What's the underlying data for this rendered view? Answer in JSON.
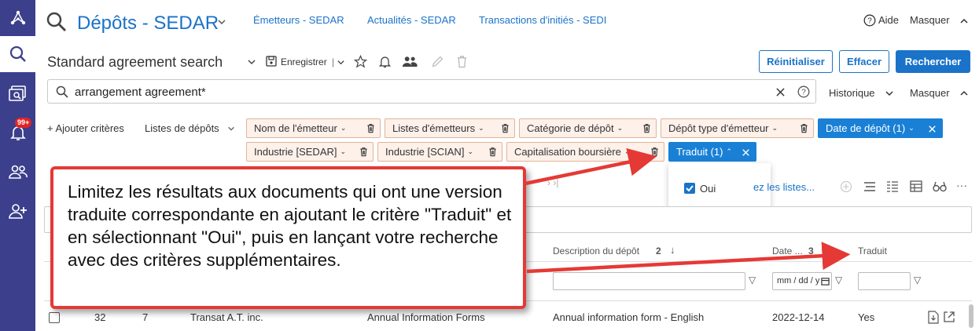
{
  "header": {
    "title": "Dépôts - SEDAR",
    "links": [
      "Émetteurs - SEDAR",
      "Actualités - SEDAR",
      "Transactions d'initiés - SEDI"
    ],
    "help_label": "Aide",
    "hide_label": "Masquer"
  },
  "nav": {
    "notification_badge": "99+"
  },
  "toolbar": {
    "search_name": "Standard agreement search",
    "save_label": "Enregistrer",
    "reset_label": "Réinitialiser",
    "clear_label": "Effacer",
    "search_label": "Rechercher"
  },
  "search": {
    "value": "arrangement agreement*",
    "history_label": "Historique",
    "hide_label": "Masquer"
  },
  "criteria": {
    "add_label": "+ Ajouter critères",
    "lists_label": "Listes de dépôts",
    "chips": [
      "Nom de l'émetteur",
      "Listes d'émetteurs",
      "Catégorie de dépôt",
      "Dépôt type d'émetteur",
      "Date de dépôt (1)",
      "Industrie [SEDAR]",
      "Industrie [SCIAN]",
      "Capitalisation boursière",
      "Traduit (1)"
    ]
  },
  "dropdown": {
    "option": "Oui",
    "checked": true
  },
  "results": {
    "lists_link": "ez les listes...",
    "columns": {
      "description": "Description du dépôt",
      "description_sort": "2",
      "date": "Date ...",
      "date_sort": "3",
      "translated": "Traduit"
    },
    "date_placeholder": "mm / dd / y",
    "row": {
      "col1": "32",
      "col2": "7",
      "issuer": "Transat A.T. inc.",
      "category": "Annual Information Forms",
      "description": "Annual information form - English",
      "date": "2022-12-14",
      "translated": "Yes"
    }
  },
  "callout": {
    "text": "Limitez les résultats aux documents qui ont une version traduite correspondante en ajoutant le critère \"Traduit\" et en sélectionnant \"Oui\", puis en lançant votre recherche avec des critères supplémentaires."
  },
  "colors": {
    "accent": "#1a73c9",
    "rail": "#3b3f8c",
    "chip": "#fdf1ea",
    "chip_active": "#1a80d6",
    "callout": "#e53935"
  }
}
